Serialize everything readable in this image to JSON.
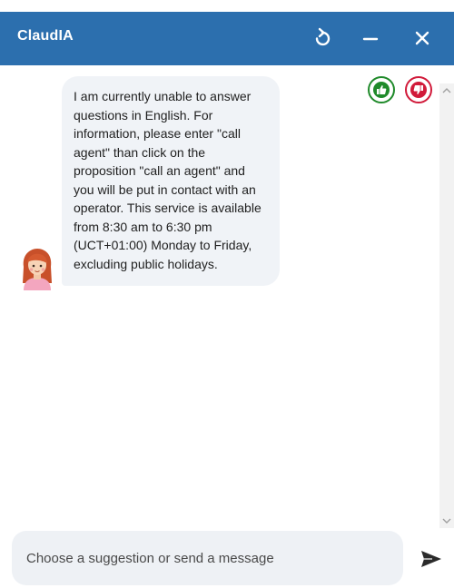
{
  "header": {
    "title": "ClaudIA",
    "background": "#2c6fae",
    "refresh_icon": "refresh-icon",
    "minimize_icon": "minimize-icon",
    "close_icon": "close-icon"
  },
  "feedback": {
    "thumbs_up_icon": "thumbs-up-icon",
    "thumbs_up_color": "#1f8a2a",
    "thumbs_down_icon": "thumbs-down-icon",
    "thumbs_down_color": "#d11a3a"
  },
  "conversation": {
    "messages": [
      {
        "sender": "bot",
        "avatar_icon": "bot-avatar",
        "text": "I am currently unable to answer questions in English. For information, please enter \"call agent\" than click on the proposition \"call an agent\" and you will be put in contact with an operator. This service is available from 8:30 am to 6:30 pm (UCT+01:00) Monday to Friday, excluding public holidays."
      }
    ]
  },
  "composer": {
    "placeholder": "Choose a suggestion or send a message",
    "value": "",
    "send_icon": "send-icon"
  }
}
